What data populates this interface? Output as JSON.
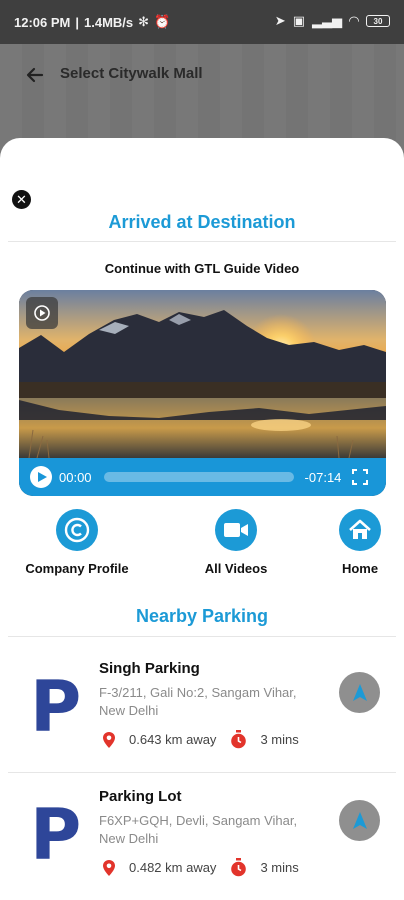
{
  "status_bar": {
    "time": "12:06 PM",
    "net_speed": "1.4MB/s",
    "battery": "30"
  },
  "appbar": {
    "title": "Select Citywalk Mall"
  },
  "sheet": {
    "title": "Arrived at Destination",
    "subtitle": "Continue with GTL Guide Video",
    "video": {
      "current_time": "00:00",
      "remaining_time": "-07:14",
      "progress": 0
    },
    "quick_actions": [
      {
        "label": "Company Profile",
        "icon": "copyright-icon"
      },
      {
        "label": "All Videos",
        "icon": "video-camera-icon"
      },
      {
        "label": "Home",
        "icon": "home-icon"
      }
    ],
    "section_title": "Nearby Parking",
    "parkings": [
      {
        "logo": "P",
        "name": "Singh Parking",
        "address": "F-3/211, Gali No:2, Sangam Vihar, New Delhi",
        "distance": "0.643 km away",
        "duration": "3 mins"
      },
      {
        "logo": "P",
        "name": "Parking Lot",
        "address": "F6XP+GQH, Devli, Sangam Vihar, New Delhi",
        "distance": "0.482 km away",
        "duration": "3 mins"
      }
    ]
  },
  "colors": {
    "accent": "#1c9ad6",
    "parking_logo": "#2e4699",
    "pin": "#e2342b",
    "nav_button": "#8f8f8f"
  }
}
